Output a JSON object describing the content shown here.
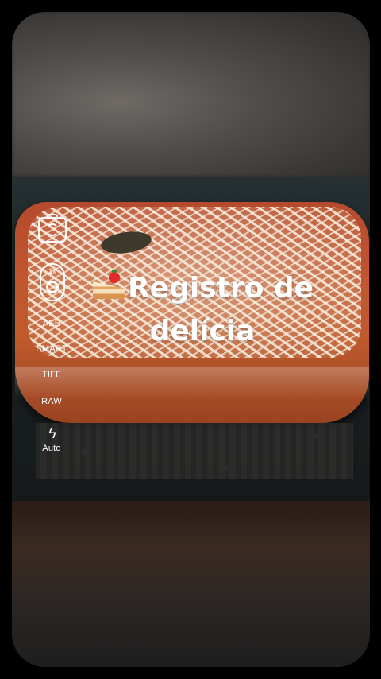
{
  "camera": {
    "zoom_label": "1x",
    "options": [
      "AEB",
      "SMART",
      "TIFF",
      "RAW"
    ],
    "flash_label": "Auto"
  },
  "caption": {
    "emoji": "cake-slice-emoji",
    "line1": "Registro de",
    "line2": "delícia"
  },
  "colors": {
    "text": "#ffffff",
    "background": "#000000"
  }
}
